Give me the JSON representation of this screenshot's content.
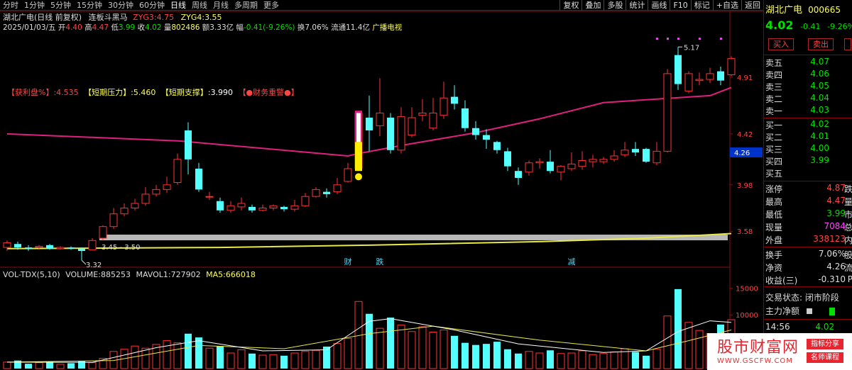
{
  "toolbar": {
    "menu": [
      "分时",
      "1分钟",
      "5分钟",
      "15分钟",
      "30分钟",
      "60分钟",
      "日线",
      "周线",
      "月线",
      "多周期",
      "更多"
    ],
    "active": "日线",
    "tools": [
      "复权",
      "叠加",
      "多股",
      "统计",
      "画线",
      "F10",
      "标记",
      "+自选",
      "返回"
    ]
  },
  "header": {
    "stock": "湖北广电(日线 前复权)",
    "indicator_name": "连板斗黑马",
    "zyg3_label": "ZYG3:",
    "zyg3_value": "4.75",
    "zyg4_label": "ZYG4:",
    "zyg4_value": "3.55"
  },
  "ohlc": {
    "date": "2025/01/03/五",
    "open_label": "开",
    "open": "4.40",
    "high_label": "高",
    "high": "4.47",
    "low_label": "低",
    "low": "3.99",
    "close_label": "收",
    "close": "4.02",
    "vol_label": "量",
    "vol": "802486",
    "amt_label": "额",
    "amt": "3.33亿",
    "chg_label": "幅",
    "chg": "-0.41(-9.26%)",
    "turnover_label": "换",
    "turnover": "7.06%",
    "float_label": "流通",
    "float": "11.4亿",
    "sector": "广播电视"
  },
  "legend": {
    "profit_label": "【获利盘%】",
    "profit": ":4.535",
    "pressure_label": "【短期压力】",
    "pressure": ":5.460",
    "support_label": "【短期支撑】",
    "support": ":3.990",
    "warning": "【●财务重警●】"
  },
  "price_labels": {
    "high_mark": "5.17",
    "low_mark": "3.32",
    "zone": "3.45 - 3.50",
    "event1": "财",
    "event2": "跌",
    "event3": "减"
  },
  "axis": {
    "price_ticks": [
      "4.91",
      "4.42",
      "3.98",
      "3.58"
    ],
    "current": "4.26",
    "vol_ticks": [
      "15000",
      "10000"
    ]
  },
  "volume_header": {
    "name": "VOL-TDX(5,10)",
    "volume_label": "VOLUME:",
    "volume": "885253",
    "mavol1_label": "MAVOL1:",
    "mavol1": "727902",
    "ma5_label": "MA5:",
    "ma5": "666018"
  },
  "quote": {
    "name": "湖北广电",
    "code": "000665",
    "price": "4.02",
    "change": "-0.41",
    "pct": "-9.26%",
    "buy_btn": "买入",
    "sell_btn": "卖出",
    "sell_levels": [
      {
        "label": "卖五",
        "price": "4.07"
      },
      {
        "label": "卖四",
        "price": "4.06"
      },
      {
        "label": "卖三",
        "price": "4.05"
      },
      {
        "label": "卖二",
        "price": "4.04"
      },
      {
        "label": "卖一",
        "price": "4.03"
      }
    ],
    "buy_levels": [
      {
        "label": "买一",
        "price": "4.02"
      },
      {
        "label": "买二",
        "price": "4.01"
      },
      {
        "label": "买三",
        "price": "4.00"
      },
      {
        "label": "买四",
        "price": "3.99"
      },
      {
        "label": "买五",
        "price": ""
      }
    ],
    "stats": [
      {
        "label": "涨停",
        "value": "4.87",
        "color": "#ff4444",
        "suffix": "跌"
      },
      {
        "label": "最高",
        "value": "4.47",
        "color": "#ff4444",
        "suffix": "量"
      },
      {
        "label": "最低",
        "value": "3.99",
        "color": "#00e000",
        "suffix": "市"
      },
      {
        "label": "现量",
        "value": "7084",
        "color": "#ff44ff",
        "suffix": "总"
      },
      {
        "label": "外盘",
        "value": "338123",
        "color": "#ff4444",
        "suffix": "内"
      }
    ],
    "stats2": [
      {
        "label": "换手",
        "value": "7.06%",
        "color": "#ddd",
        "suffix": "股"
      },
      {
        "label": "净资",
        "value": "4.26",
        "color": "#ddd",
        "suffix": "流"
      },
      {
        "label": "收益(三)",
        "value": "-0.310",
        "color": "#ddd",
        "suffix": "P"
      }
    ],
    "trade_status": "交易状态: 闭市阶段",
    "main_flow": "主力净额",
    "time": "14:56",
    "time_price": "4.02"
  },
  "watermark": {
    "title": "股市财富网",
    "url": "WWW.GSCFW.COM",
    "tag1": "指标分享",
    "tag2": "名师课程"
  },
  "colors": {
    "up": "#ff3232",
    "down": "#54ffff",
    "ma_pink": "#e0207f",
    "ma_yellow": "#e8e84a",
    "highlight": "#ffee00"
  },
  "chart_data": {
    "type": "candlestick",
    "price_range": [
      3.3,
      5.3
    ],
    "candles": [
      [
        3.44,
        3.48,
        3.41,
        3.5
      ],
      [
        3.47,
        3.44,
        3.42,
        3.49
      ],
      [
        3.44,
        3.43,
        3.41,
        3.46
      ],
      [
        3.44,
        3.45,
        3.42,
        3.46
      ],
      [
        3.46,
        3.43,
        3.42,
        3.47
      ],
      [
        3.43,
        3.44,
        3.42,
        3.45
      ],
      [
        3.44,
        3.43,
        3.42,
        3.45
      ],
      [
        3.43,
        3.41,
        3.33,
        3.44
      ],
      [
        3.42,
        3.5,
        3.42,
        3.52
      ],
      [
        3.52,
        3.62,
        3.5,
        3.63
      ],
      [
        3.62,
        3.73,
        3.6,
        3.78
      ],
      [
        3.73,
        3.78,
        3.71,
        3.82
      ],
      [
        3.78,
        3.82,
        3.76,
        3.86
      ],
      [
        3.82,
        3.9,
        3.8,
        3.96
      ],
      [
        3.9,
        3.94,
        3.88,
        3.98
      ],
      [
        3.94,
        3.98,
        3.91,
        4.05
      ],
      [
        4.0,
        4.2,
        3.98,
        4.25
      ],
      [
        4.45,
        4.2,
        4.07,
        4.52
      ],
      [
        4.12,
        3.94,
        3.92,
        4.17
      ],
      [
        3.88,
        3.88,
        3.85,
        3.92
      ],
      [
        3.84,
        3.76,
        3.74,
        3.87
      ],
      [
        3.76,
        3.8,
        3.74,
        3.84
      ],
      [
        3.79,
        3.82,
        3.76,
        3.87
      ],
      [
        3.79,
        3.76,
        3.74,
        3.81
      ],
      [
        3.76,
        3.78,
        3.75,
        3.81
      ],
      [
        3.78,
        3.8,
        3.76,
        3.81
      ],
      [
        3.79,
        3.77,
        3.75,
        3.8
      ],
      [
        3.77,
        3.8,
        3.75,
        3.85
      ],
      [
        3.8,
        3.88,
        3.79,
        3.91
      ],
      [
        3.88,
        3.94,
        3.87,
        3.96
      ],
      [
        3.92,
        3.9,
        3.87,
        3.95
      ],
      [
        3.92,
        3.98,
        3.9,
        4.04
      ],
      [
        4.01,
        4.12,
        4.0,
        4.17
      ],
      [
        4.12,
        4.6,
        4.1,
        4.62
      ],
      [
        4.56,
        4.45,
        4.27,
        4.75
      ],
      [
        4.49,
        4.6,
        4.4,
        4.9
      ],
      [
        4.56,
        4.28,
        4.25,
        4.6
      ],
      [
        4.28,
        4.57,
        4.25,
        4.65
      ],
      [
        4.41,
        4.56,
        4.39,
        4.65
      ],
      [
        4.58,
        4.6,
        4.53,
        4.72
      ],
      [
        4.47,
        4.6,
        4.45,
        4.73
      ],
      [
        4.58,
        4.73,
        4.55,
        4.87
      ],
      [
        4.74,
        4.68,
        4.63,
        4.84
      ],
      [
        4.64,
        4.47,
        4.44,
        4.71
      ],
      [
        4.47,
        4.41,
        4.37,
        4.53
      ],
      [
        4.41,
        4.37,
        4.29,
        4.46
      ],
      [
        4.35,
        4.28,
        4.25,
        4.36
      ],
      [
        4.27,
        4.14,
        4.1,
        4.3
      ],
      [
        4.1,
        4.04,
        3.98,
        4.13
      ],
      [
        4.09,
        4.17,
        4.06,
        4.19
      ],
      [
        4.17,
        4.18,
        4.12,
        4.21
      ],
      [
        4.18,
        4.1,
        4.08,
        4.28
      ],
      [
        4.09,
        4.14,
        4.02,
        4.15
      ],
      [
        4.12,
        4.16,
        4.1,
        4.26
      ],
      [
        4.14,
        4.19,
        4.11,
        4.27
      ],
      [
        4.18,
        4.2,
        4.13,
        4.24
      ],
      [
        4.18,
        4.2,
        4.16,
        4.22
      ],
      [
        4.2,
        4.23,
        4.18,
        4.28
      ],
      [
        4.24,
        4.28,
        4.22,
        4.35
      ],
      [
        4.29,
        4.26,
        4.23,
        4.35
      ],
      [
        4.29,
        4.18,
        4.17,
        4.3
      ],
      [
        4.17,
        4.27,
        4.15,
        4.35
      ],
      [
        4.27,
        4.94,
        4.26,
        4.98
      ],
      [
        5.1,
        4.85,
        4.8,
        5.17
      ],
      [
        4.79,
        4.94,
        4.77,
        4.96
      ],
      [
        4.88,
        4.89,
        4.84,
        4.95
      ],
      [
        4.89,
        4.94,
        4.86,
        4.99
      ],
      [
        4.96,
        4.88,
        4.84,
        5.0
      ],
      [
        4.93,
        5.07,
        4.92,
        5.09
      ]
    ],
    "ma_long": [
      [
        0,
        4.42
      ],
      [
        16,
        4.36
      ],
      [
        32,
        4.23
      ],
      [
        33,
        4.25
      ],
      [
        37,
        4.32
      ],
      [
        44,
        4.43
      ],
      [
        50,
        4.55
      ],
      [
        56,
        4.69
      ],
      [
        66,
        4.75
      ],
      [
        68,
        4.82
      ]
    ],
    "ma_yellow": [
      [
        0,
        3.43
      ],
      [
        20,
        3.44
      ],
      [
        34,
        3.46
      ],
      [
        50,
        3.49
      ],
      [
        60,
        3.52
      ],
      [
        68,
        3.56
      ]
    ],
    "volume": [
      1200,
      1500,
      900,
      1100,
      1300,
      800,
      1000,
      1400,
      1100,
      1900,
      3200,
      3600,
      4200,
      3800,
      4500,
      5200,
      4800,
      6500,
      5800,
      3800,
      4200,
      2900,
      3500,
      2800,
      2500,
      2600,
      2400,
      2900,
      3200,
      3400,
      4100,
      4700,
      5600,
      12500,
      10200,
      7500,
      9500,
      8100,
      6900,
      7800,
      6800,
      7200,
      6100,
      4800,
      4400,
      4600,
      5000,
      3600,
      2800,
      3200,
      2900,
      3400,
      2800,
      2900,
      3300,
      2600,
      2800,
      3100,
      3700,
      3100,
      2400,
      3600,
      9800,
      14800,
      8600,
      7100,
      6500,
      8200,
      9100
    ],
    "mavol_white": [
      [
        0,
        1200
      ],
      [
        8,
        1150
      ],
      [
        14,
        3900
      ],
      [
        18,
        5200
      ],
      [
        24,
        3300
      ],
      [
        30,
        3500
      ],
      [
        34,
        8800
      ],
      [
        36,
        9300
      ],
      [
        42,
        7200
      ],
      [
        48,
        4600
      ],
      [
        56,
        3000
      ],
      [
        60,
        3300
      ],
      [
        63,
        6900
      ],
      [
        66,
        8900
      ],
      [
        68,
        8600
      ]
    ],
    "mavol_yellow": [
      [
        0,
        1200
      ],
      [
        10,
        1500
      ],
      [
        18,
        4300
      ],
      [
        26,
        3700
      ],
      [
        34,
        6500
      ],
      [
        40,
        7900
      ],
      [
        50,
        5300
      ],
      [
        60,
        3300
      ],
      [
        64,
        5200
      ],
      [
        68,
        7200
      ]
    ],
    "vol_range": [
      0,
      16500
    ]
  }
}
